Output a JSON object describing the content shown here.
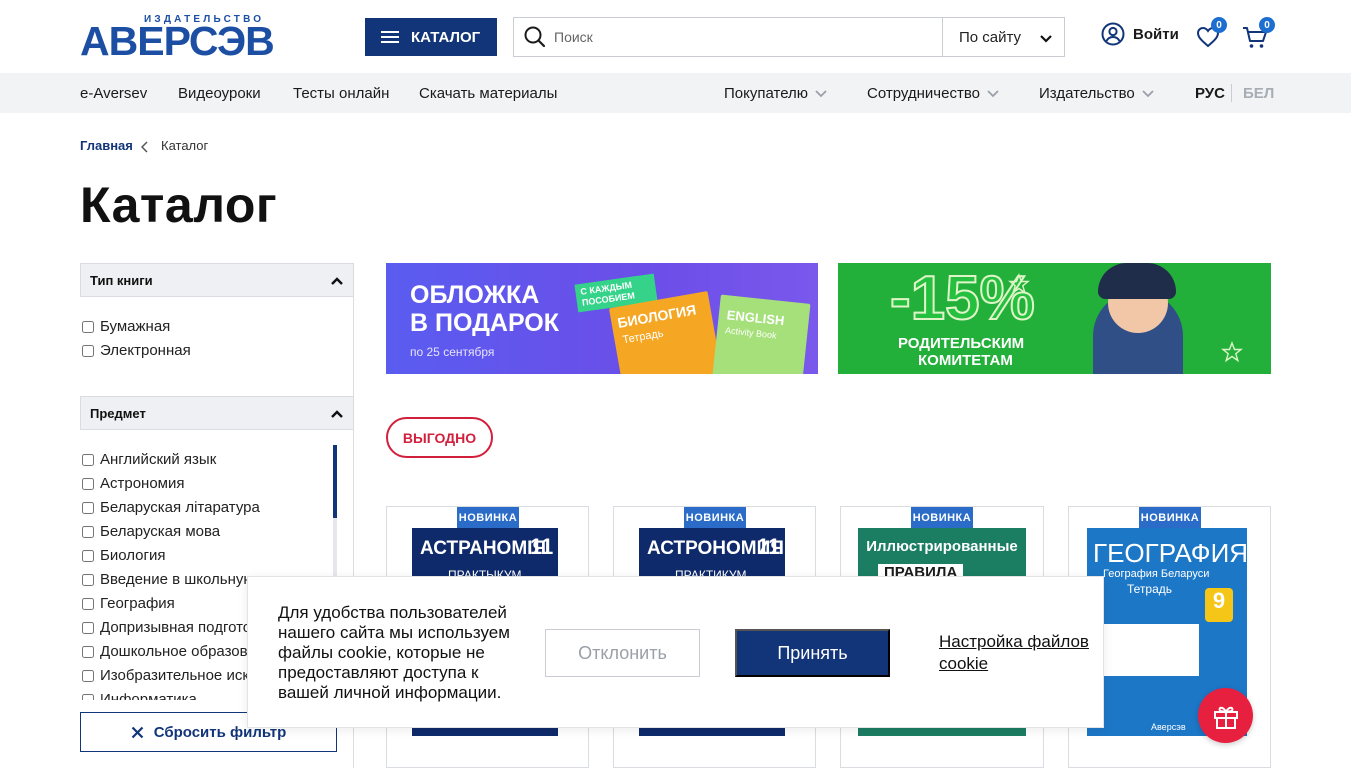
{
  "header": {
    "logo_top": "ИЗДАТЕЛЬСТВО",
    "logo_main": "АВЕРСЭВ",
    "catalog_label": "КАТАЛОГ",
    "search_placeholder": "Поиск",
    "search_scope": "По сайту",
    "login_label": "Войти",
    "favorites_count": "0",
    "cart_count": "0"
  },
  "nav": {
    "left": [
      "e-Aversev",
      "Видеоуроки",
      "Тесты онлайн",
      "Скачать материалы"
    ],
    "right": [
      "Покупателю",
      "Сотрудничество",
      "Издательство"
    ],
    "lang_active": "РУС",
    "lang_other": "БЕЛ"
  },
  "breadcrumb": {
    "home": "Главная",
    "current": "Каталог"
  },
  "page_title": "Каталог",
  "filters": {
    "book_type": {
      "title": "Тип книги",
      "options": [
        "Бумажная",
        "Электронная"
      ]
    },
    "subject": {
      "title": "Предмет",
      "options": [
        "Английский язык",
        "Астрономия",
        "Беларуская літаратура",
        "Беларуская мова",
        "Биология",
        "Введение в школьную жизнь",
        "География",
        "Допризывная подготовка",
        "Дошкольное образование",
        "Изобразительное искусство",
        "Информатика"
      ]
    },
    "reset_label": "Сбросить фильтр"
  },
  "banners": {
    "b1": {
      "line1": "ОБЛОЖКА",
      "line2": "В ПОДАРОК",
      "date": "по 25 сентября",
      "sticker": "С КАЖДЫМ ПОСОБИЕМ",
      "book1": "БИОЛОГИЯ",
      "book1_sub": "Тетрадь",
      "book2": "ENGLISH",
      "book2_sub": "Activity Book"
    },
    "b2": {
      "percent": "-15%",
      "line1": "РОДИТЕЛЬСКИМ",
      "line2": "КОМИТЕТАМ"
    }
  },
  "promo_pill": "ВЫГОДНО",
  "products": [
    {
      "tag": "НОВИНКА",
      "title": "АСТРАНОМІЯ",
      "grade": "11",
      "sub": "ПРАКТЫКУМ"
    },
    {
      "tag": "НОВИНКА",
      "title": "АСТРОНОМИЯ",
      "grade": "11",
      "sub": "ПРАКТИКУМ"
    },
    {
      "tag": "НОВИНКА",
      "title": "Иллюстрированные",
      "sub": "ПРАВИЛА"
    },
    {
      "tag": "НОВИНКА",
      "title": "ГЕОГРАФИЯ",
      "sub": "География Беларуси",
      "sub2": "Тетрадь",
      "grade": "9",
      "publisher": "Аверсэв"
    }
  ],
  "cookie": {
    "text": "Для удобства пользователей нашего сайта мы используем файлы cookie, которые не предоставляют доступа к вашей личной информации.",
    "decline": "Отклонить",
    "accept": "Принять",
    "settings": "Настройка файлов cookie"
  },
  "colors": {
    "brand": "#12357a",
    "accent_red": "#d21f3c",
    "tag_blue": "#2a6cc7",
    "nav_bg": "#f2f3f5"
  }
}
